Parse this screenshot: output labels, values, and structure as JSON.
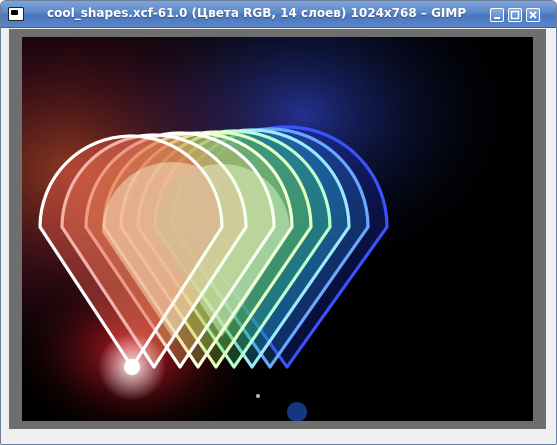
{
  "window": {
    "title": "cool_shapes.xcf-61.0 (Цвета RGB, 14 слоев) 1024x768 – GIMP",
    "icon": "gimp-icon"
  },
  "controls": {
    "minimize_icon": "minimize-icon",
    "maximize_icon": "maximize-icon",
    "close_icon": "close-icon"
  },
  "colors": {
    "titlebar": "#5b87c9",
    "frame": "#6e6e6e",
    "canvas_bg": "#000000"
  }
}
